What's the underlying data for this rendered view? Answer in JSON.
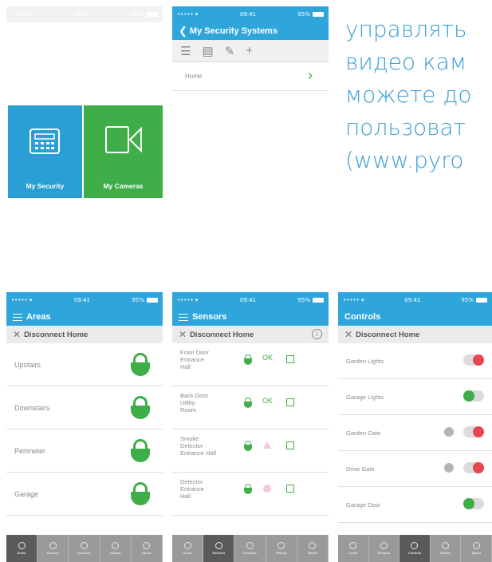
{
  "status_bar": {
    "time": "09:41",
    "battery": "95%"
  },
  "phone1": {
    "tiles": [
      {
        "label": "My Security",
        "color": "#2a9fd6"
      },
      {
        "label": "My Cameras",
        "color": "#3fae49"
      }
    ]
  },
  "phone2": {
    "title": "My Security Systems",
    "items": [
      {
        "label": "Home"
      }
    ]
  },
  "russian_text": {
    "lines": [
      "управлять",
      "видео кам",
      "можете до",
      "пользоват"
    ],
    "link": "(www.pyro"
  },
  "areas_screen": {
    "title": "Areas",
    "subtitle": "Disconnect Home",
    "rows": [
      {
        "label": "Upstairs"
      },
      {
        "label": "Downstairs"
      },
      {
        "label": "Perimeter"
      },
      {
        "label": "Garage"
      }
    ]
  },
  "sensors_screen": {
    "title": "Sensors",
    "subtitle": "Disconnect Home",
    "rows": [
      {
        "l1": "Front Door",
        "l2": "Entrance",
        "l3": "Hall",
        "status": "OK"
      },
      {
        "l1": "Back Door",
        "l2": "Utility",
        "l3": "Room",
        "status": "OK"
      },
      {
        "l1": "Smoke",
        "l2": "Detector",
        "l3": "Entrance Hall",
        "status": ""
      },
      {
        "l1": "Detector",
        "l2": "Entrance",
        "l3": "Hall",
        "status": ""
      }
    ]
  },
  "controls_screen": {
    "title": "Controls",
    "subtitle": "Disconnect Home",
    "rows": [
      {
        "label": "Garden Lights",
        "state": "on"
      },
      {
        "label": "Garage Lights",
        "state": "off"
      },
      {
        "label": "Garden Gate",
        "state": "on"
      },
      {
        "label": "Drive Gate",
        "state": "on"
      },
      {
        "label": "Garage Door",
        "state": "off"
      }
    ]
  },
  "tabs": [
    "Areas",
    "Sensors",
    "Controls",
    "History",
    "About"
  ],
  "colors": {
    "accent_blue": "#2ea6dc",
    "green": "#3fae49",
    "red": "#e8474f"
  }
}
